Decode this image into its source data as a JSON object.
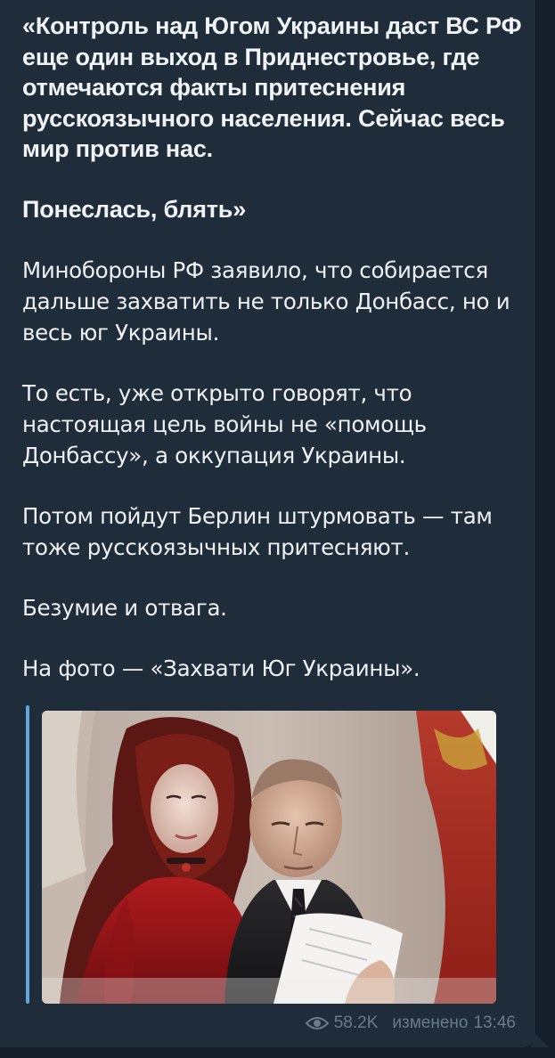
{
  "message": {
    "paragraphs": [
      {
        "text": "«Контроль над Югом Украины даст ВС РФ еще один выход в Приднестровье, где отмечаются факты притеснения русскоязычного населения. Сейчас весь мир против нас.",
        "bold": true
      },
      {
        "text": "Понеслась, блять»",
        "bold": true
      },
      {
        "text": "Минобороны РФ заявило, что собирается дальше захватить не только Донбасс, но и весь юг Украины.",
        "bold": false
      },
      {
        "text": "То есть, уже открыто говорят, что настоящая цель войны не «помощь Донбассу», а оккупация Украины.",
        "bold": false
      },
      {
        "text": "Потом пойдут Берлин штурмовать — там тоже русскоязычных притесняют.",
        "bold": false
      },
      {
        "text": "Безумие и отвага.",
        "bold": false
      },
      {
        "text": "На фото — «Захвати Юг Украины».",
        "bold": false
      }
    ]
  },
  "preview": {
    "accent_color": "#5fa7de",
    "image_description": "photo"
  },
  "footer": {
    "views_icon": "eye-icon",
    "views": "58.2K",
    "edited_label": "изменено",
    "time": "13:46"
  }
}
